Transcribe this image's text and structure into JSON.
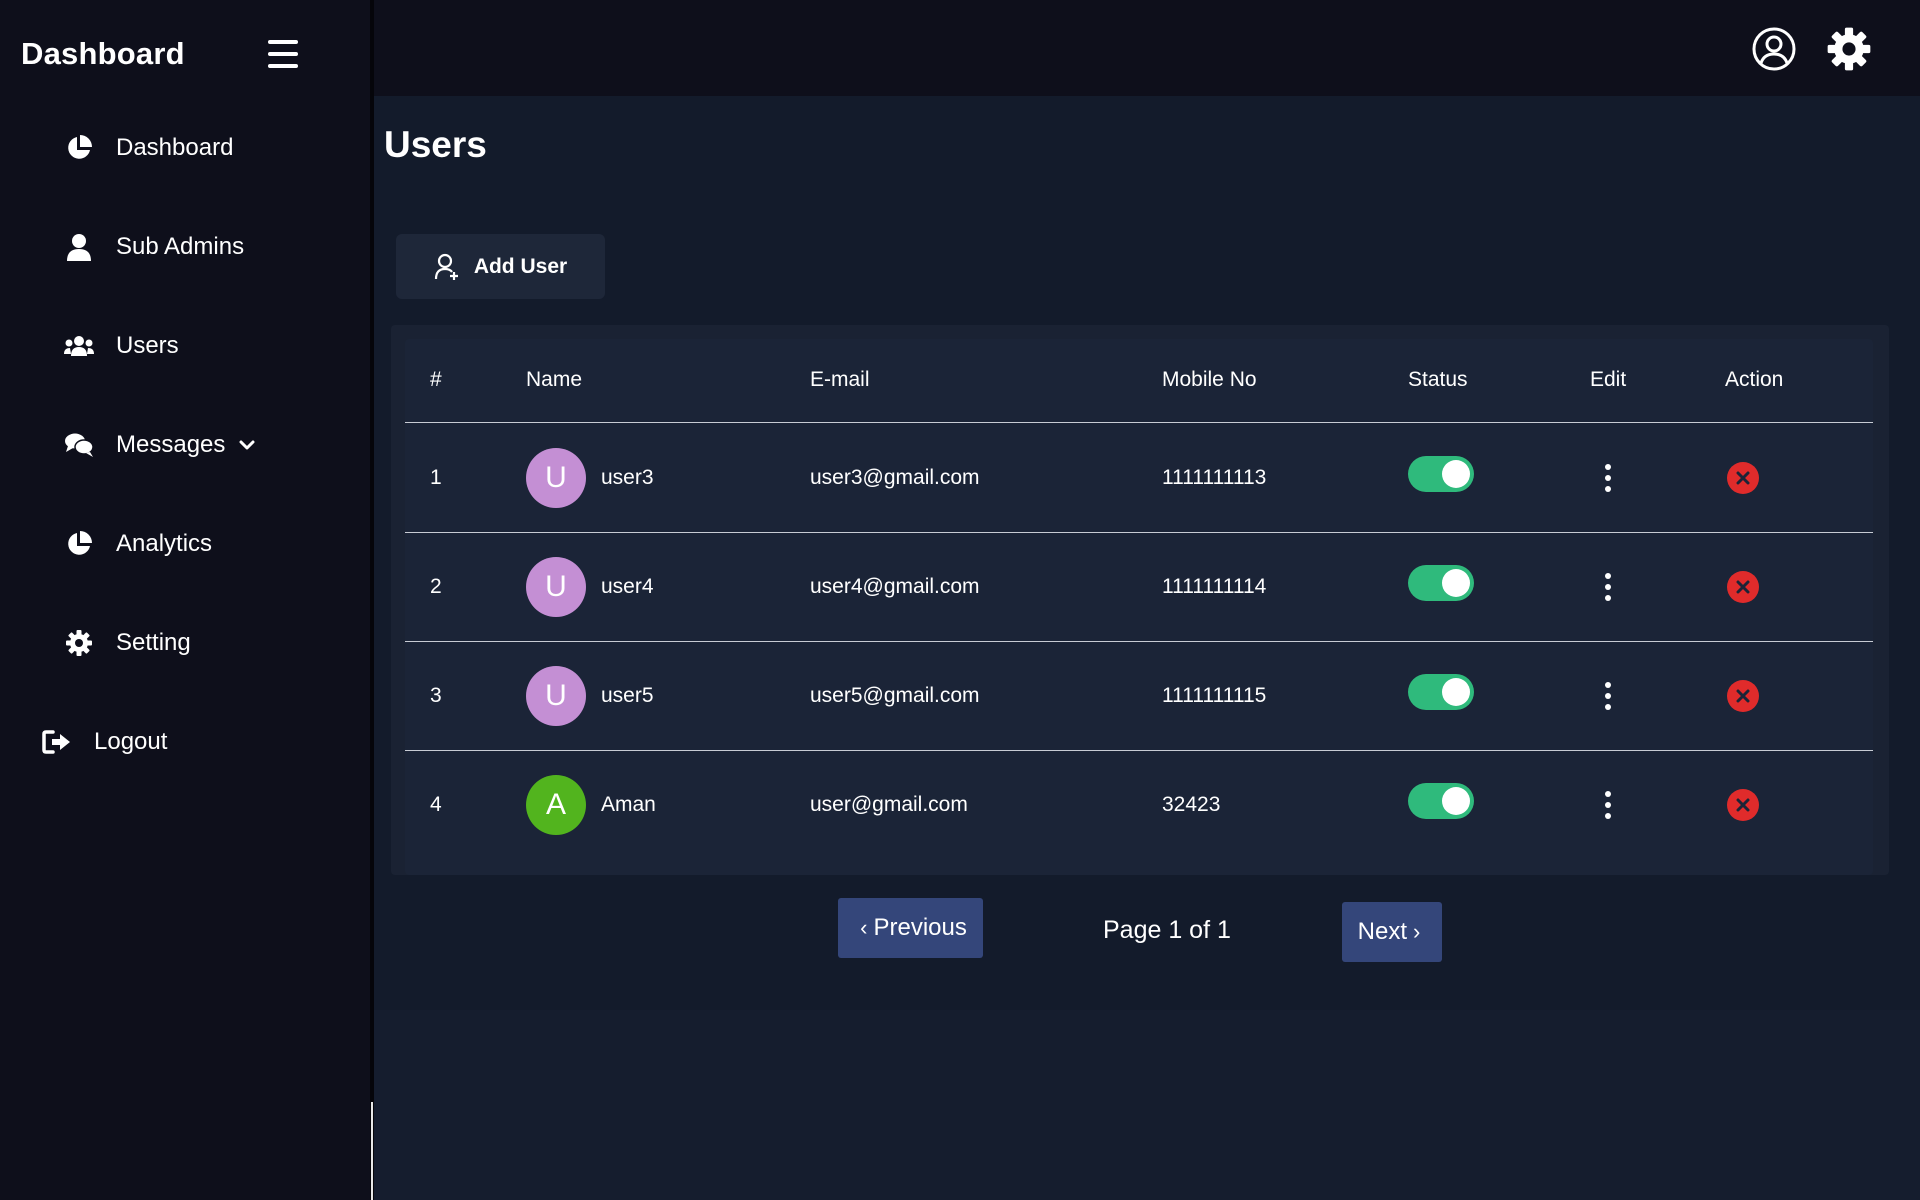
{
  "sidebar": {
    "brand": "Dashboard",
    "items": [
      {
        "label": "Dashboard"
      },
      {
        "label": "Sub Admins"
      },
      {
        "label": "Users"
      },
      {
        "label": "Messages"
      },
      {
        "label": "Analytics"
      },
      {
        "label": "Setting"
      },
      {
        "label": "Logout"
      }
    ]
  },
  "topbar": {
    "icons": [
      "user-circle-icon",
      "gear-icon"
    ]
  },
  "main": {
    "title": "Users",
    "add_user_label": "Add User",
    "table": {
      "headers": [
        "#",
        "Name",
        "E-mail",
        "Mobile No",
        "Status",
        "Edit",
        "Action"
      ],
      "rows": [
        {
          "index": "1",
          "initial": "U",
          "name": "user3",
          "email": "user3@gmail.com",
          "mobile": "1111111113",
          "status": true,
          "avatar_color": "#c48fd4"
        },
        {
          "index": "2",
          "initial": "U",
          "name": "user4",
          "email": "user4@gmail.com",
          "mobile": "1111111114",
          "status": true,
          "avatar_color": "#c48fd4"
        },
        {
          "index": "3",
          "initial": "U",
          "name": "user5",
          "email": "user5@gmail.com",
          "mobile": "1111111115",
          "status": true,
          "avatar_color": "#c48fd4"
        },
        {
          "index": "4",
          "initial": "A",
          "name": "Aman",
          "email": "user@gmail.com",
          "mobile": "32423",
          "status": true,
          "avatar_color": "#52b41e"
        }
      ]
    },
    "pagination": {
      "previous_label": "Previous",
      "next_label": "Next",
      "page_info": "Page 1 of 1"
    }
  },
  "colors": {
    "toggle_on": "#2fba7c",
    "delete": "#e02b2b",
    "pager_button": "#34467a"
  }
}
